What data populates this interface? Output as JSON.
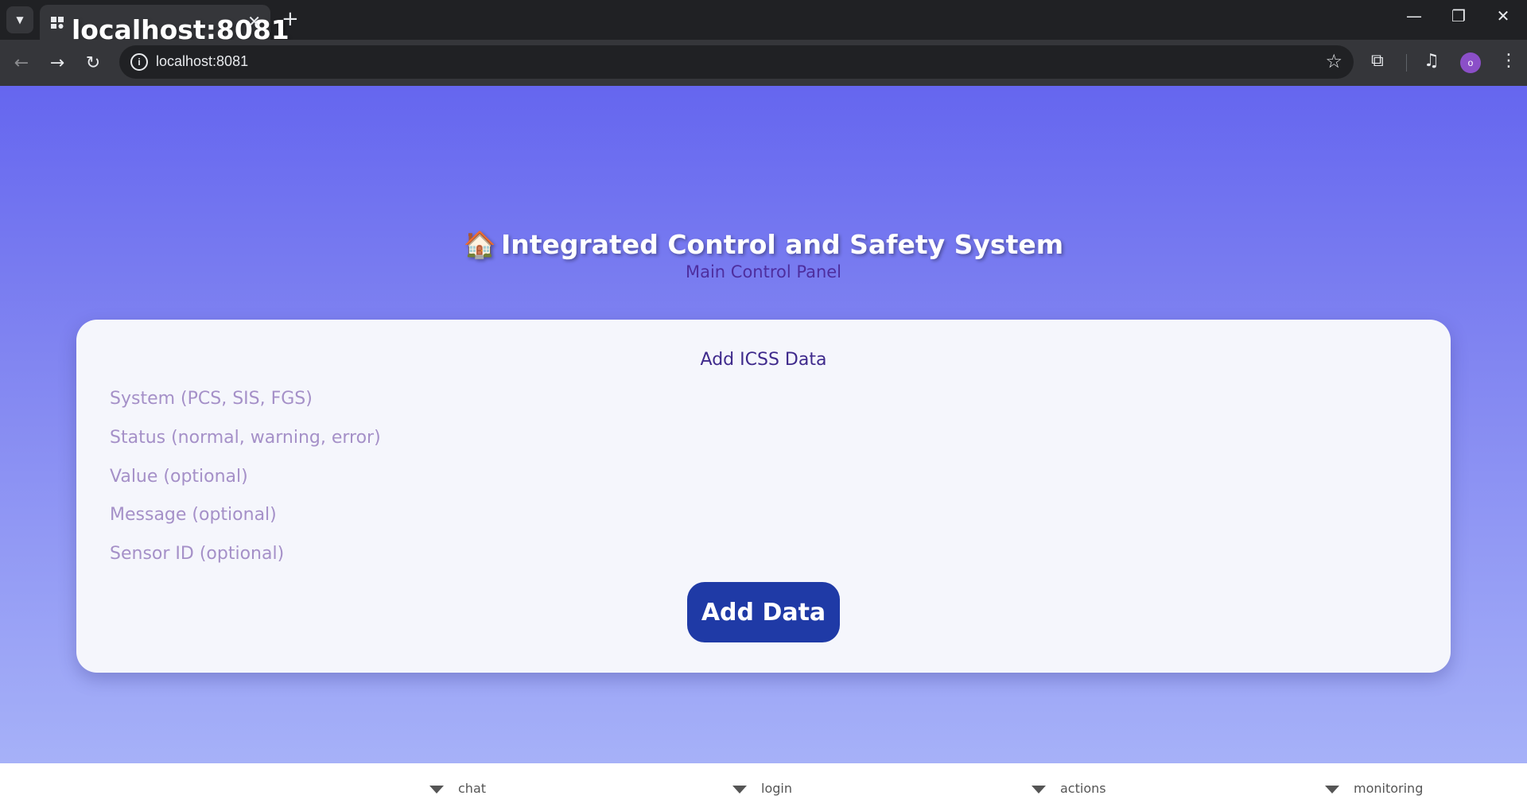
{
  "browser": {
    "tab_title": "localhost:8081",
    "url": "localhost:8081",
    "profile_initial": "o"
  },
  "header": {
    "icon": "🏠",
    "title": "Integrated Control and Safety System",
    "subtitle": "Main Control Panel"
  },
  "form": {
    "heading": "Add ICSS Data",
    "fields": [
      {
        "placeholder": "System (PCS, SIS, FGS)",
        "value": ""
      },
      {
        "placeholder": "Status (normal, warning, error)",
        "value": ""
      },
      {
        "placeholder": "Value (optional)",
        "value": ""
      },
      {
        "placeholder": "Message (optional)",
        "value": ""
      },
      {
        "placeholder": "Sensor ID (optional)",
        "value": ""
      }
    ],
    "submit_label": "Add Data"
  },
  "bottom_nav": {
    "items": [
      {
        "label": "chat"
      },
      {
        "label": "login"
      },
      {
        "label": "actions"
      },
      {
        "label": "monitoring"
      }
    ]
  },
  "colors": {
    "button": "#1f3aa6",
    "gradient_top": "#6566ef",
    "gradient_bottom": "#a6b1f8",
    "subtitle": "#4e2e9e"
  }
}
